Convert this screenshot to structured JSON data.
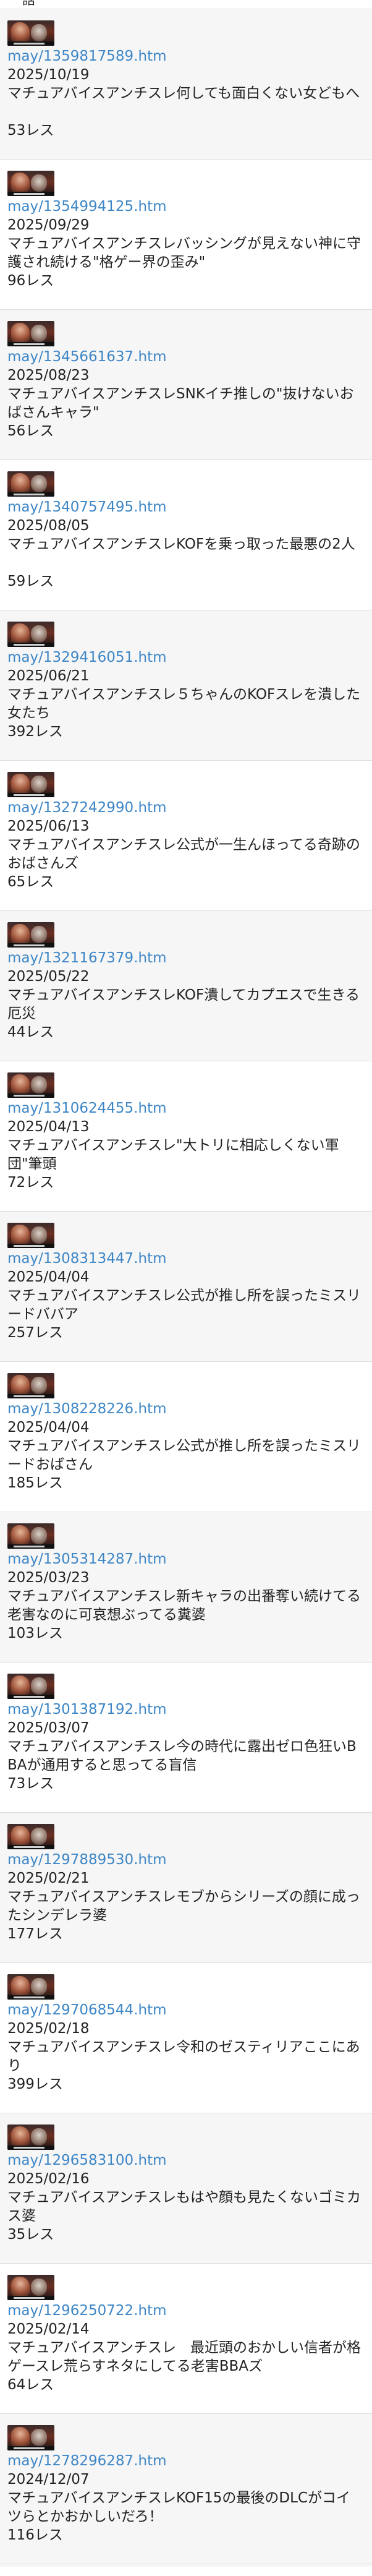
{
  "top_fragment": "話",
  "threads": [
    {
      "link": "may/1359817589.htm",
      "date": "2025/10/19",
      "title": "マチュアバイスアンチスレ何しても面白くない女どもへ",
      "count": "53レス"
    },
    {
      "link": "may/1354994125.htm",
      "date": "2025/09/29",
      "title": "マチュアバイスアンチスレバッシングが見えない神に守護され続ける\"格ゲー界の歪み\"",
      "count": "96レス"
    },
    {
      "link": "may/1345661637.htm",
      "date": "2025/08/23",
      "title": "マチュアバイスアンチスレSNKイチ推しの\"抜けないおばさんキャラ\"",
      "count": "56レス"
    },
    {
      "link": "may/1340757495.htm",
      "date": "2025/08/05",
      "title": "マチュアバイスアンチスレKOFを乗っ取った最悪の2人",
      "count": "59レス"
    },
    {
      "link": "may/1329416051.htm",
      "date": "2025/06/21",
      "title": "マチュアバイスアンチスレ５ちゃんのKOFスレを潰した女たち",
      "count": "392レス"
    },
    {
      "link": "may/1327242990.htm",
      "date": "2025/06/13",
      "title": "マチュアバイスアンチスレ公式が一生んほってる奇跡のおばさんズ",
      "count": "65レス"
    },
    {
      "link": "may/1321167379.htm",
      "date": "2025/05/22",
      "title": "マチュアバイスアンチスレKOF潰してカプエスで生きる厄災",
      "count": "44レス"
    },
    {
      "link": "may/1310624455.htm",
      "date": "2025/04/13",
      "title": "マチュアバイスアンチスレ\"大トリに相応しくない軍団\"筆頭",
      "count": "72レス"
    },
    {
      "link": "may/1308313447.htm",
      "date": "2025/04/04",
      "title": "マチュアバイスアンチスレ公式が推し所を誤ったミスリードババア",
      "count": "257レス"
    },
    {
      "link": "may/1308228226.htm",
      "date": "2025/04/04",
      "title": "マチュアバイスアンチスレ公式が推し所を誤ったミスリードおばさん",
      "count": "185レス"
    },
    {
      "link": "may/1305314287.htm",
      "date": "2025/03/23",
      "title": "マチュアバイスアンチスレ新キャラの出番奪い続けてる老害なのに可哀想ぶってる糞婆",
      "count": "103レス"
    },
    {
      "link": "may/1301387192.htm",
      "date": "2025/03/07",
      "title": "マチュアバイスアンチスレ今の時代に露出ゼロ色狂いBBAが通用すると思ってる盲信",
      "count": "73レス"
    },
    {
      "link": "may/1297889530.htm",
      "date": "2025/02/21",
      "title": "マチュアバイスアンチスレモブからシリーズの顔に成ったシンデレラ婆",
      "count": "177レス"
    },
    {
      "link": "may/1297068544.htm",
      "date": "2025/02/18",
      "title": "マチュアバイスアンチスレ令和のゼスティリアここにあり",
      "count": "399レス"
    },
    {
      "link": "may/1296583100.htm",
      "date": "2025/02/16",
      "title": "マチュアバイスアンチスレもはや顔も見たくないゴミカス婆",
      "count": "35レス"
    },
    {
      "link": "may/1296250722.htm",
      "date": "2025/02/14",
      "title": "マチュアバイスアンチスレ　最近頭のおかしい信者が格ゲースレ荒らすネタにしてる老害BBAズ",
      "count": "64レス"
    },
    {
      "link": "may/1278296287.htm",
      "date": "2024/12/07",
      "title": "マチュアバイスアンチスレKOF15の最後のDLCがコイツらとかおかしいだろ！",
      "count": "116レス"
    }
  ]
}
